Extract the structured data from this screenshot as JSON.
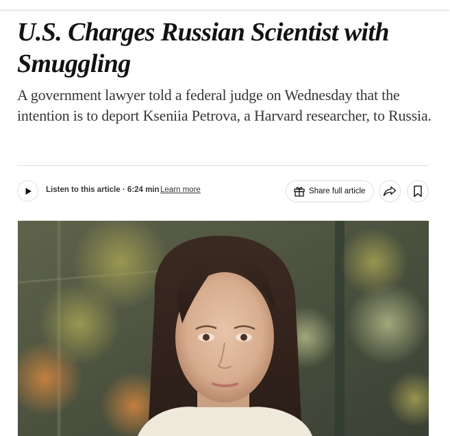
{
  "article": {
    "headline": "U.S. Charges Russian Scientist with Smuggling",
    "summary": "A government lawyer told a federal judge on Wednesday that the intention is to deport Kseniia Petrova, a Harvard researcher, to Russia."
  },
  "toolbar": {
    "listen_label": "Listen to this article · 6:24 min",
    "learn_more_label": "Learn more",
    "share_full_label": "Share full article",
    "icons": {
      "play": "play-icon",
      "gift": "gift-icon",
      "share": "share-arrow-icon",
      "save": "bookmark-icon"
    }
  },
  "colors": {
    "text": "#121212",
    "summary_text": "#363636",
    "border": "#dfdfdf"
  }
}
